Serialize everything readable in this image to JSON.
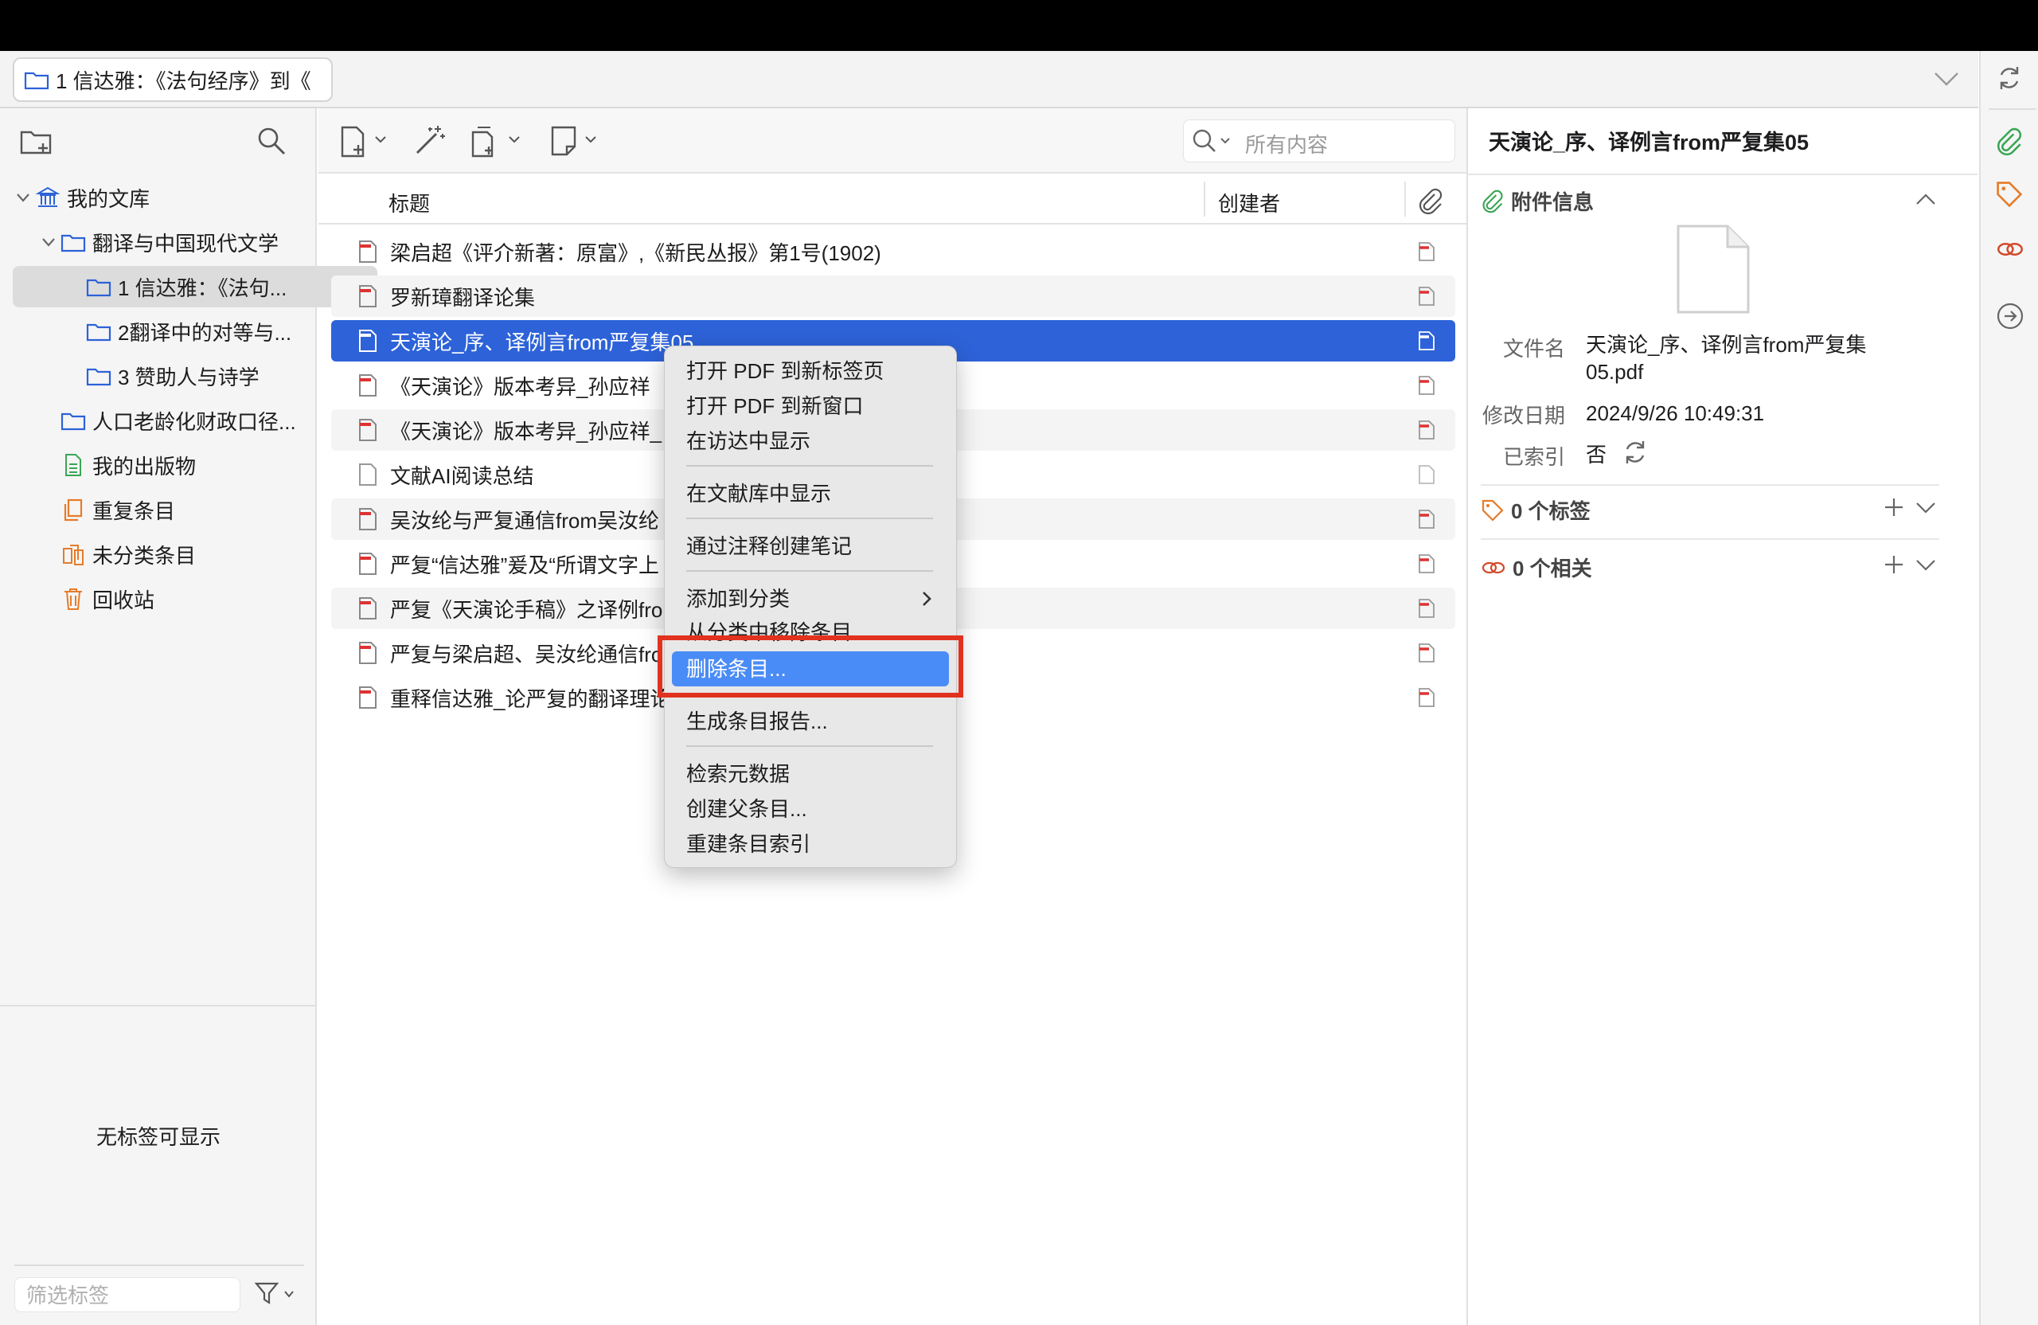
{
  "tab": {
    "label": "1 信达雅：《法句经序》到《"
  },
  "collections": {
    "items": [
      {
        "label": "我的文库"
      },
      {
        "label": "翻译与中国现代文学"
      },
      {
        "label": "1 信达雅：《法句..."
      },
      {
        "label": "2翻译中的对等与..."
      },
      {
        "label": "3 赞助人与诗学"
      },
      {
        "label": "人口老龄化财政口径..."
      },
      {
        "label": "我的出版物"
      },
      {
        "label": "重复条目"
      },
      {
        "label": "未分类条目"
      },
      {
        "label": "回收站"
      }
    ],
    "no_tags": "无标签可显示",
    "tag_filter_placeholder": "筛选标签"
  },
  "toolbar": {
    "search_placeholder": "所有内容"
  },
  "items_table": {
    "columns": {
      "title": "标题",
      "creator": "创建者"
    },
    "rows": [
      {
        "title": "梁启超《评介新著：原富》,《新民丛报》第1号(1902)"
      },
      {
        "title": "罗新璋翻译论集"
      },
      {
        "title": "天演论_序、译例言from严复集05"
      },
      {
        "title": "《天演论》版本考异_孙应祥"
      },
      {
        "title": "《天演论》版本考异_孙应祥_"
      },
      {
        "title": "文献AI阅读总结"
      },
      {
        "title": "吴汝纶与严复通信from吴汝纶"
      },
      {
        "title": "严复“信达雅”爰及“所谓文字上"
      },
      {
        "title": "严复《天演论手稿》之译例fro"
      },
      {
        "title": "严复与梁启超、吴汝纶通信fro"
      },
      {
        "title": "重释信达雅_论严复的翻译理论"
      }
    ]
  },
  "context_menu": {
    "items": [
      "打开 PDF 到新标签页",
      "打开 PDF 到新窗口",
      "在访达中显示",
      "在文献库中显示",
      "通过注释创建笔记",
      "添加到分类",
      "从分类中移除条目",
      "删除条目...",
      "生成条目报告...",
      "检索元数据",
      "创建父条目...",
      "重建条目索引"
    ]
  },
  "item_pane": {
    "title": "天演论_序、译例言from严复集05",
    "attachment_section": "附件信息",
    "filename_label": "文件名",
    "filename_value": "天演论_序、译例言from严复集05.pdf",
    "modified_label": "修改日期",
    "modified_value": "2024/9/26 10:49:31",
    "indexed_label": "已索引",
    "indexed_value": "否",
    "tags_section": "0 个标签",
    "related_section": "0 个相关"
  },
  "colors": {
    "selection": "#2d62d8",
    "menu_highlight": "#4a8cf7",
    "annotation_box": "#e1321f",
    "accent_green": "#3aa655",
    "accent_orange": "#e57c2a"
  }
}
